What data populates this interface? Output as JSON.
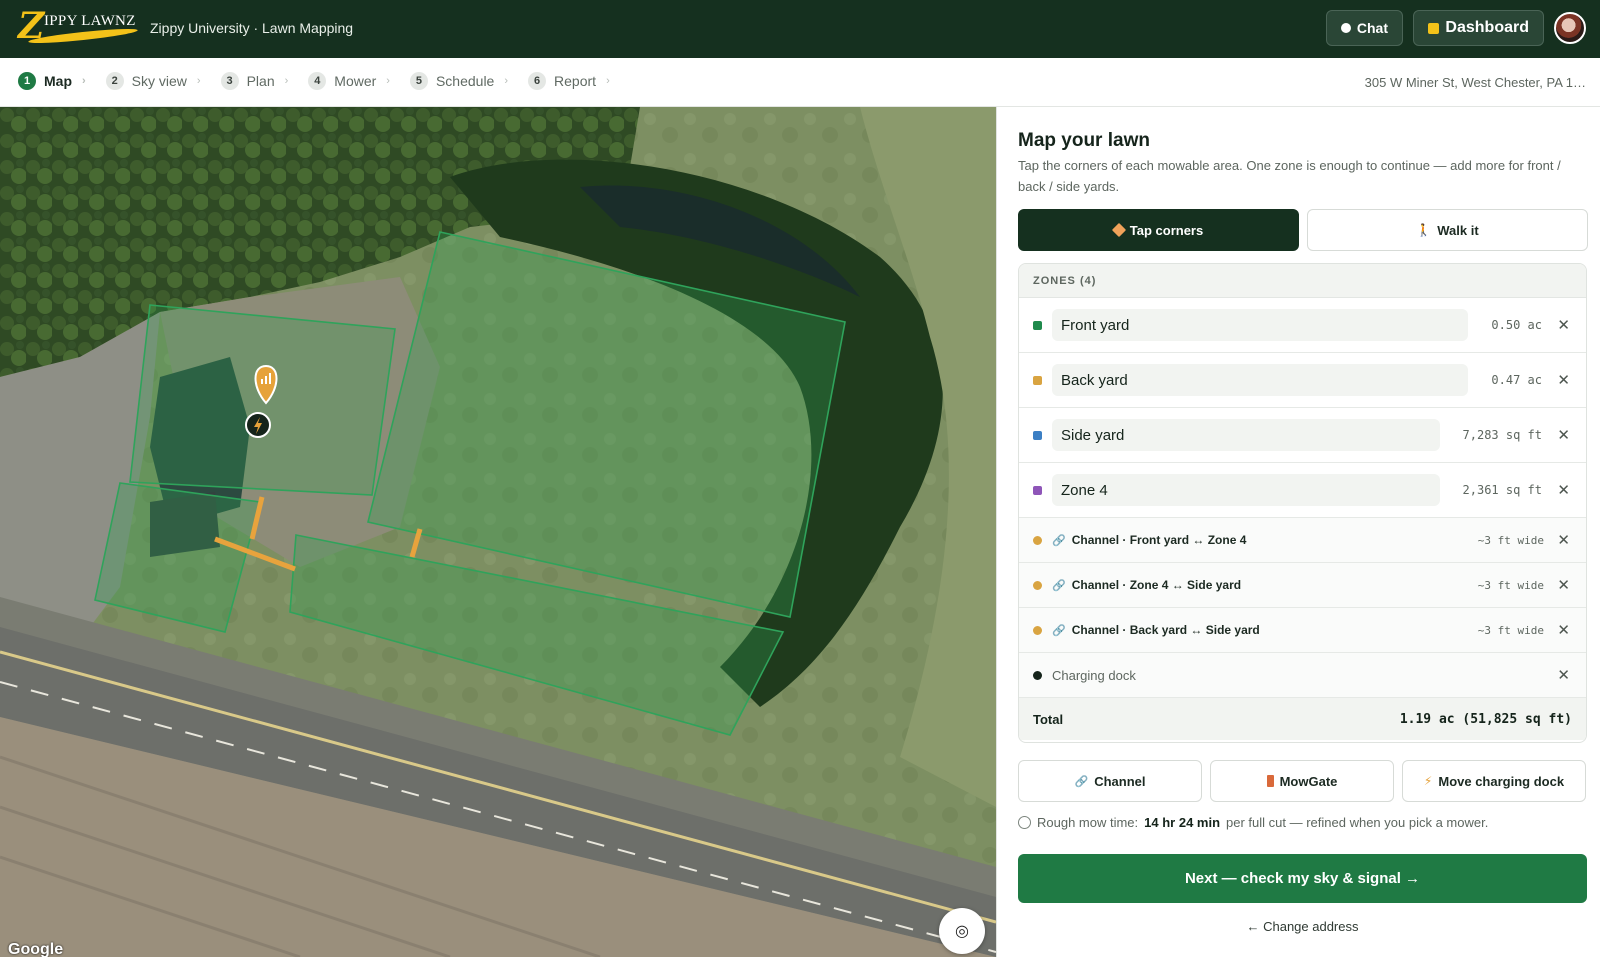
{
  "brand": {
    "logo_letter": "Z",
    "logo_rest": "IPPY LAWNZ",
    "title": "Zippy University · Lawn Mapping"
  },
  "header": {
    "chat_label": "Chat",
    "dashboard_label": "Dashboard"
  },
  "steps": [
    {
      "num": "1",
      "label": "Map",
      "active": true
    },
    {
      "num": "2",
      "label": "Sky view"
    },
    {
      "num": "3",
      "label": "Plan"
    },
    {
      "num": "4",
      "label": "Mower"
    },
    {
      "num": "5",
      "label": "Schedule"
    },
    {
      "num": "6",
      "label": "Report"
    }
  ],
  "address": "305 W Miner St, West Chester, PA 1…",
  "map": {
    "attribution": "Google",
    "locate_icon": "locate-target-icon"
  },
  "panel": {
    "title": "Map your lawn",
    "description": "Tap the corners of each mowable area. One zone is enough to continue — add more for front / back / side yards.",
    "modes": {
      "tap": "Tap corners",
      "walk": "Walk it"
    },
    "zones_header": "ZONES (4)",
    "zones": [
      {
        "name": "Front yard",
        "area": "0.50 ac",
        "color": "#1f8a4c"
      },
      {
        "name": "Back yard",
        "area": "0.47 ac",
        "color": "#d9a441"
      },
      {
        "name": "Side yard",
        "area": "7,283 sq ft",
        "color": "#3b7fc4"
      },
      {
        "name": "Zone 4",
        "area": "2,361 sq ft",
        "color": "#8e55b8"
      }
    ],
    "channels": [
      {
        "name": "Channel · Front yard ↔ Zone 4",
        "width": "~3 ft wide"
      },
      {
        "name": "Channel · Zone 4 ↔ Side yard",
        "width": "~3 ft wide"
      },
      {
        "name": "Channel · Back yard ↔ Side yard",
        "width": "~3 ft wide"
      }
    ],
    "dock": "Charging dock",
    "total_label": "Total",
    "total_value": "1.19 ac (51,825 sq ft)",
    "tools": {
      "channel": "Channel",
      "mowgate": "MowGate",
      "dock": "Move charging dock"
    },
    "mow_prefix": "Rough mow time:",
    "mow_time": "14 hr 24 min",
    "mow_suffix": "per full cut — refined when you pick a mower.",
    "next_label": "Next — check my sky & signal →",
    "change_label": "← Change address"
  },
  "colors": {
    "header_bg": "#15301f",
    "accent": "#1f7a44",
    "channel": "#d9a441",
    "dock": "#15241b"
  }
}
